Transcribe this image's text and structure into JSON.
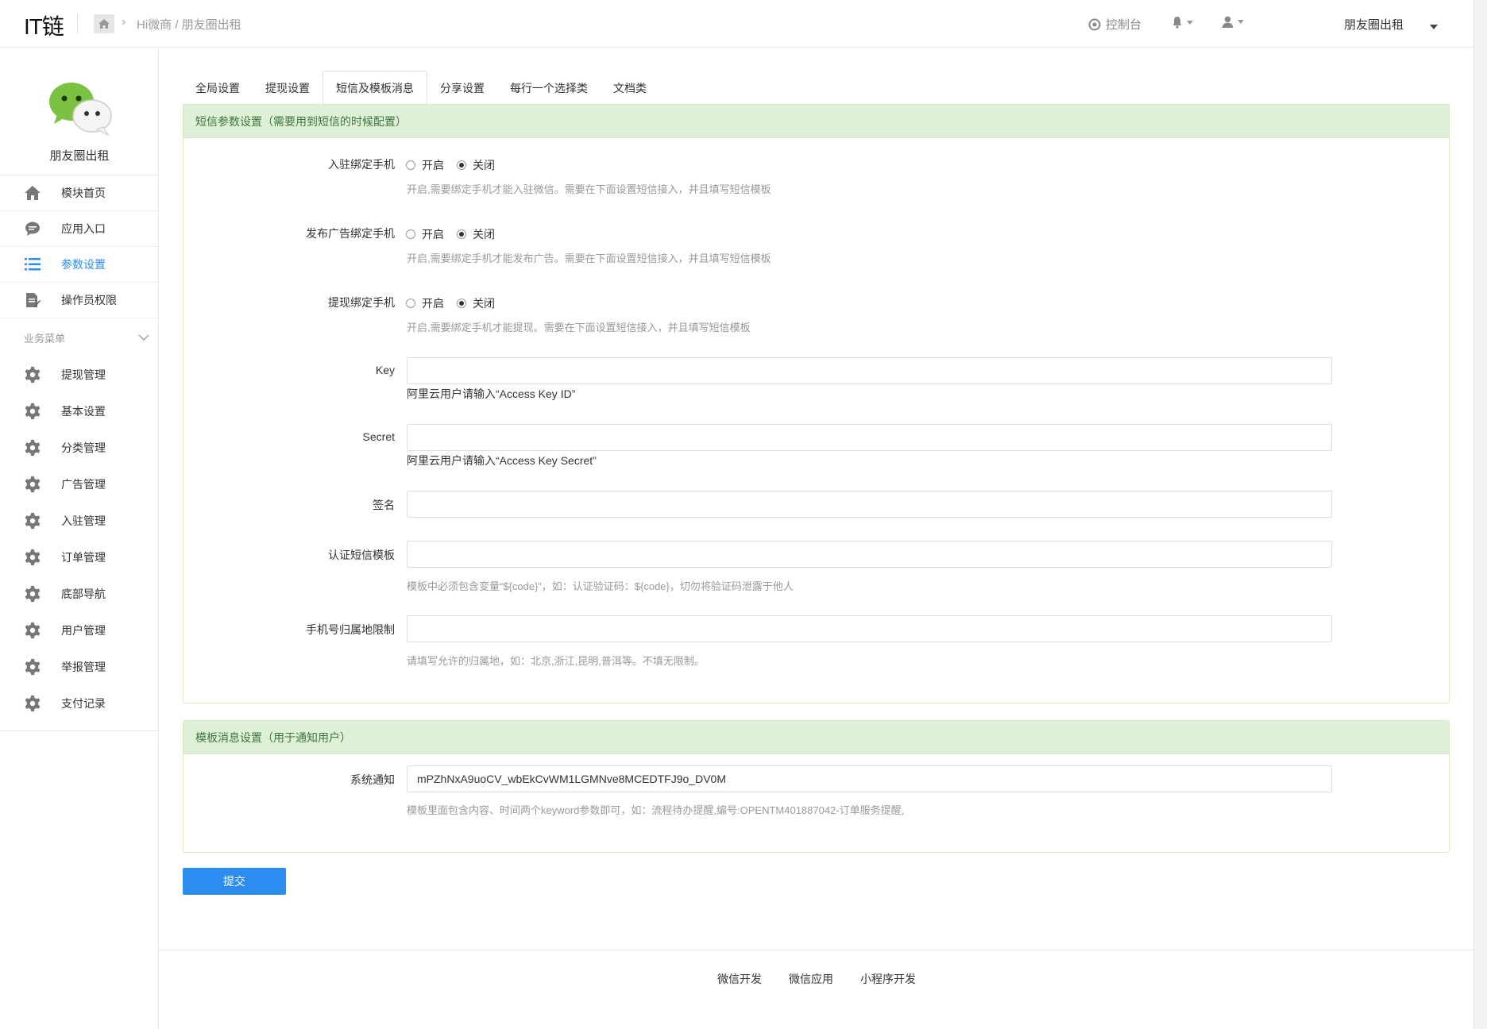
{
  "header": {
    "logo": "IT链",
    "breadcrumb": "Hi微商 / 朋友圈出租",
    "console_label": "控制台",
    "account_label": "朋友圈出租"
  },
  "sidebar": {
    "app_name": "朋友圈出租",
    "nav": [
      {
        "label": "模块首页",
        "icon": "home-icon"
      },
      {
        "label": "应用入口",
        "icon": "chat-icon"
      },
      {
        "label": "参数设置",
        "icon": "list-icon",
        "active": true
      },
      {
        "label": "操作员权限",
        "icon": "edit-doc-icon"
      }
    ],
    "group_title": "业务菜单",
    "biz": [
      {
        "label": "提现管理"
      },
      {
        "label": "基本设置"
      },
      {
        "label": "分类管理"
      },
      {
        "label": "广告管理"
      },
      {
        "label": "入驻管理"
      },
      {
        "label": "订单管理"
      },
      {
        "label": "底部导航"
      },
      {
        "label": "用户管理"
      },
      {
        "label": "举报管理"
      },
      {
        "label": "支付记录"
      }
    ]
  },
  "tabs": [
    {
      "label": "全局设置"
    },
    {
      "label": "提现设置"
    },
    {
      "label": "短信及模板消息",
      "active": true
    },
    {
      "label": "分享设置"
    },
    {
      "label": "每行一个选择类"
    },
    {
      "label": "文档类"
    }
  ],
  "sms_panel": {
    "title": "短信参数设置（需要用到短信的时候配置）",
    "radio_on": "开启",
    "radio_off": "关闭",
    "settle_label": "入驻绑定手机",
    "settle_help": "开启,需要绑定手机才能入驻微信。需要在下面设置短信接入，并且填写短信模板",
    "ad_label": "发布广告绑定手机",
    "ad_help": "开启,需要绑定手机才能发布广告。需要在下面设置短信接入，并且填写短信模板",
    "withdraw_label": "提现绑定手机",
    "withdraw_help": "开启,需要绑定手机才能提现。需要在下面设置短信接入，并且填写短信模板",
    "key_label": "Key",
    "key_value": "",
    "key_help": "阿里云用户请输入“Access Key ID”",
    "secret_label": "Secret",
    "secret_value": "",
    "secret_help": "阿里云用户请输入“Access Key Secret”",
    "sign_label": "签名",
    "sign_value": "",
    "verify_label": "认证短信模板",
    "verify_value": "",
    "verify_help": "模板中必须包含变量“${code}”，如：认证验证码：${code}，切勿将验证码泄露于他人",
    "region_label": "手机号归属地限制",
    "region_value": "",
    "region_help": "请填写允许的归属地，如：北京,浙江,昆明,普洱等。不填无限制。"
  },
  "tpl_panel": {
    "title": "模板消息设置（用于通知用户）",
    "notify_label": "系统通知",
    "notify_value": "mPZhNxA9uoCV_wbEkCvWM1LGMNve8MCEDTFJ9o_DV0M",
    "notify_help": "模板里面包含内容、时间两个keyword参数即可，如：流程待办提醒,编号:OPENTM401887042-订单服务提醒,"
  },
  "submit_label": "提交",
  "footer": {
    "links": [
      {
        "label": "微信开发"
      },
      {
        "label": "微信应用"
      },
      {
        "label": "小程序开发"
      }
    ]
  },
  "colors": {
    "primary": "#2d8cf0",
    "panel_head_bg": "#dff0d8",
    "panel_head_text": "#3c763d",
    "wechat_green": "#7bc142"
  }
}
